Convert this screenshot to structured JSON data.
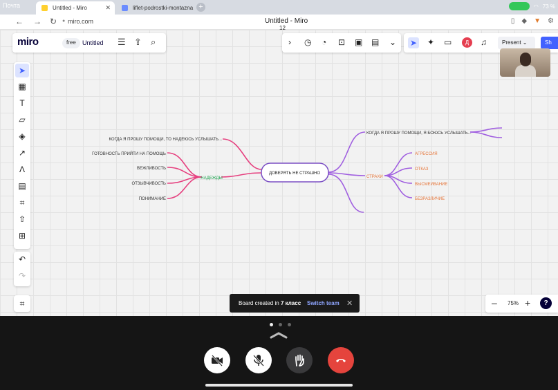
{
  "status": {
    "left_text": "Почта",
    "battery": "73 %"
  },
  "tabs": [
    {
      "label": "Untitled - Miro",
      "active": true
    },
    {
      "label": "liflet-podrostki-montazna",
      "active": false
    }
  ],
  "address": {
    "url": "miro.com",
    "page_title": "Untitled - Miro",
    "overlay_number": "12"
  },
  "miro": {
    "logo": "miro",
    "plan_badge": "free",
    "board_title": "Untitled"
  },
  "collab": {
    "avatar_initial": "Д",
    "present_label": "Present",
    "share_label": "Sh"
  },
  "left_tools": [
    "select",
    "templates",
    "text",
    "sticky-note",
    "shapes",
    "pen",
    "comment",
    "frame",
    "upload",
    "add"
  ],
  "toast": {
    "prefix": "Board created in",
    "team": "7 класс",
    "switch_label": "Switch team"
  },
  "zoom": {
    "minus": "–",
    "level": "75%",
    "plus": "+",
    "help": "?"
  },
  "mindmap": {
    "center": "ДОВЕРЯТЬ НЕ СТРАШНО",
    "left_branch": "НАДЕЖДЫ",
    "left_items": [
      "КОГДА Я ПРОШУ ПОМОЩИ, ТО НАДЕЮСЬ УСЛЫШАТЬ...",
      "ГОТОВНОСТЬ ПРИЙТИ НА ПОМОЩЬ",
      "ВЕЖЛИВОСТЬ",
      "ОТЗЫВЧИВОСТЬ",
      "ПОНИМАНИЕ"
    ],
    "right_top": "КОГДА Я ПРОШУ ПОМОЩИ, Я БОЮСЬ УСЛЫШАТЬ...",
    "right_branch": "СТРАХИ",
    "right_items": [
      "АГРЕССИЯ",
      "ОТКАЗ",
      "ВЫСМЕИВАНИЕ",
      "БЕЗРАЗЛИЧИЕ"
    ]
  },
  "colors": {
    "accent": "#4262ff",
    "pink": "#e6407f",
    "purple": "#a05fe0",
    "green": "#1ba34d",
    "orange": "#e6763a",
    "end_call": "#e5443d"
  }
}
